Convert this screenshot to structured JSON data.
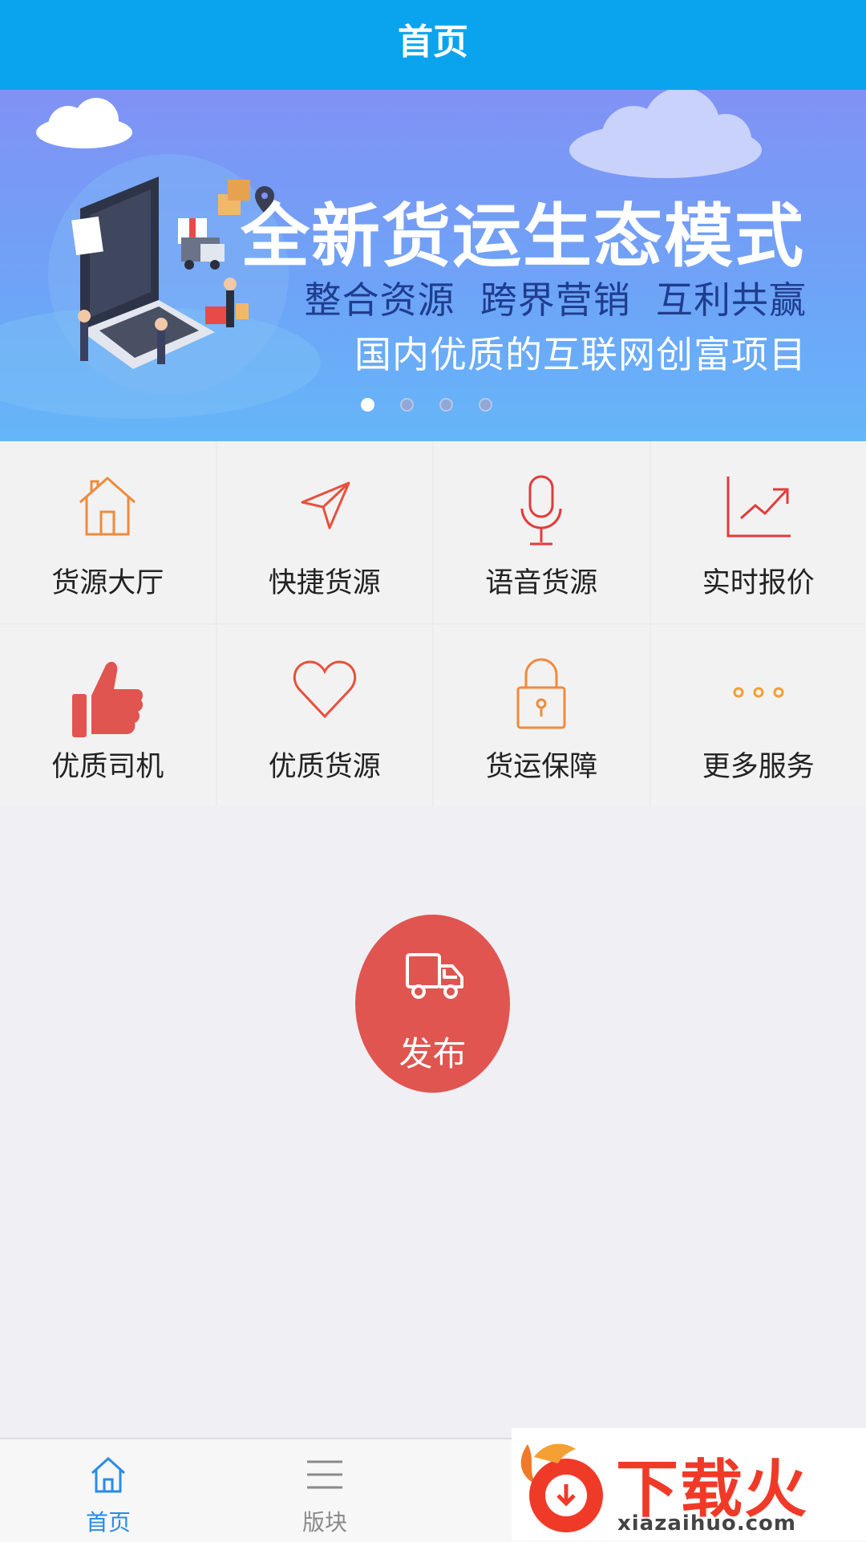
{
  "nav": {
    "title": "首页"
  },
  "banner": {
    "title": "全新货运生态模式",
    "subtitle1": "整合资源  跨界营销  互利共赢",
    "subtitle2": "国内优质的互联网创富项目",
    "active_slide": 1,
    "slide_count": 4
  },
  "grid": {
    "items": [
      {
        "label": "货源大厅",
        "icon": "house-icon"
      },
      {
        "label": "快捷货源",
        "icon": "paper-plane-icon"
      },
      {
        "label": "语音货源",
        "icon": "microphone-icon"
      },
      {
        "label": "实时报价",
        "icon": "trend-chart-icon"
      },
      {
        "label": "优质司机",
        "icon": "thumbs-up-icon"
      },
      {
        "label": "优质货源",
        "icon": "heart-icon"
      },
      {
        "label": "货运保障",
        "icon": "lock-icon"
      },
      {
        "label": "更多服务",
        "icon": "more-dots-icon"
      }
    ]
  },
  "publish": {
    "label": "发布",
    "icon": "truck-icon"
  },
  "tabs": [
    {
      "label": "首页",
      "icon": "home-icon",
      "active": true
    },
    {
      "label": "版块",
      "icon": "menu-icon",
      "active": false
    }
  ],
  "watermark": {
    "text": "下载火",
    "url": "xiazaihuo.com"
  },
  "colors": {
    "nav": "#0aa4ee",
    "accent_red": "#e05550",
    "icon_orange": "#f08a3c",
    "active_tab": "#2a8be6"
  }
}
